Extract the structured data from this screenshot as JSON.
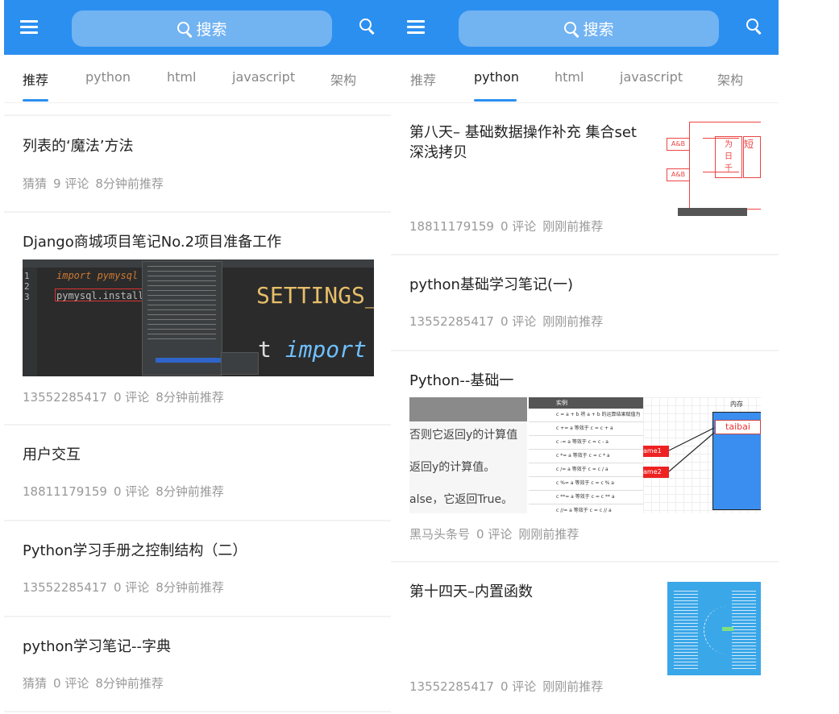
{
  "search": {
    "label": "搜索"
  },
  "tabs": [
    "推荐",
    "python",
    "html",
    "javascript",
    "架构"
  ],
  "left_feed": {
    "active_tab": "推荐",
    "articles": [
      {
        "title": "列表的‘魔法’方法",
        "author": "猜猜",
        "comments": "9 评论",
        "time": "8分钟前推荐"
      },
      {
        "title": "Django商城项目笔记No.2项目准备工作",
        "author": "13552285417",
        "comments": "0 评论",
        "time": "8分钟前推荐",
        "image": {
          "line1_num": "1",
          "line1_code": "import pymysql",
          "line2_num": "2",
          "line3_num": "3",
          "line3_code": "pymysql.install_a",
          "big1": "SETTINGS_",
          "big2_t": "t",
          "big2_kw": "import"
        }
      },
      {
        "title": "用户交互",
        "author": "18811179159",
        "comments": "0 评论",
        "time": "8分钟前推荐"
      },
      {
        "title": "Python学习手册之控制结构（二）",
        "author": "13552285417",
        "comments": "0 评论",
        "time": "8分钟前推荐"
      },
      {
        "title": "python学习笔记--字典",
        "author": "猜猜",
        "comments": "0 评论",
        "time": "8分钟前推荐"
      }
    ]
  },
  "right_feed": {
    "active_tab": "python",
    "articles": [
      {
        "title": "第八天– 基础数据操作补充 集合set 深浅拷贝",
        "author": "18811179159",
        "comments": "0 评论",
        "time": "刚刚前推荐"
      },
      {
        "title": "python基础学习笔记(一)",
        "author": "13552285417",
        "comments": "0 评论",
        "time": "刚刚前推荐"
      },
      {
        "title": "Python--基础一",
        "author": "黑马头条号",
        "comments": "0 评论",
        "time": "刚刚前推荐",
        "image": {
          "header": "实例",
          "memory_label": "内存",
          "box_text": "taibai",
          "left_lines": [
            "否则它返回y的计算值",
            "返回y的计算值。",
            "alse，它返回True。"
          ],
          "rows": [
            "c = a + b 将 a + b 的运算结果赋值为",
            "c += a 等效于 c = c + a",
            "c -= a 等效于 c = c - a",
            "c *= a 等效于 c = c * a",
            "c /= a 等效于 c = c / a",
            "c %= a 等效于 c = c % a",
            "c **= a 等效于 c = c ** a",
            "c //= a 等效于 c = c // a"
          ],
          "tags": [
            "ame1",
            "ame2"
          ]
        }
      },
      {
        "title": "第十四天–内置函数",
        "author": "13552285417",
        "comments": "0 评论",
        "time": "刚刚前推荐"
      }
    ]
  },
  "icons": {
    "menu": "menu-icon",
    "search": "search-icon"
  },
  "colors": {
    "brand": "#2b8ff0",
    "search_bg": "#72b3f2",
    "meta": "#999999"
  }
}
